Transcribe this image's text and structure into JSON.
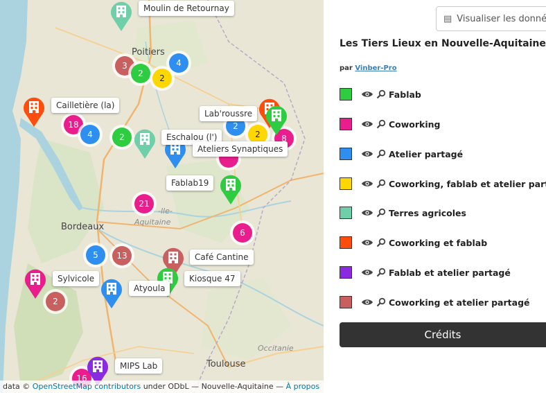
{
  "map": {
    "cities": [
      {
        "id": "poitiers",
        "name": "Poitiers"
      },
      {
        "id": "bordeaux",
        "name": "Bordeaux"
      },
      {
        "id": "toulouse",
        "name": "Toulouse"
      }
    ],
    "region_label_1": "-lle-",
    "region_label_2": "Aquitaine",
    "region_label_3": "Occitanie",
    "clusters": [
      {
        "count": "3",
        "color": "#c86060"
      },
      {
        "count": "2",
        "color": "#2ecc40"
      },
      {
        "count": "4",
        "color": "#2f8ff0"
      },
      {
        "count": "2",
        "color": "#ffd700"
      },
      {
        "count": "18",
        "color": "#e91e8c"
      },
      {
        "count": "4",
        "color": "#2f8ff0"
      },
      {
        "count": "2",
        "color": "#2ecc40"
      },
      {
        "count": "2",
        "color": "#2f8ff0"
      },
      {
        "count": "2",
        "color": "#ffd700"
      },
      {
        "count": "8",
        "color": "#e91e8c"
      },
      {
        "count": "21",
        "color": "#e91e8c"
      },
      {
        "count": "6",
        "color": "#e91e8c"
      },
      {
        "count": "5",
        "color": "#2f8ff0"
      },
      {
        "count": "13",
        "color": "#c86060"
      },
      {
        "count": "2",
        "color": "#c86060"
      },
      {
        "count": "16",
        "color": "#e91e8c"
      }
    ],
    "pins": [
      {
        "color": "#6fcfa8"
      },
      {
        "color": "#ff4d0d"
      },
      {
        "color": "#6fcfa8"
      },
      {
        "color": "#2f8ff0"
      },
      {
        "color": "#ff4d0d"
      },
      {
        "color": "#2ecc40"
      },
      {
        "color": "#2ecc40"
      },
      {
        "color": "#c86060"
      },
      {
        "color": "#2ecc40"
      },
      {
        "color": "#e91e8c"
      },
      {
        "color": "#2f8ff0"
      },
      {
        "color": "#8a2be2"
      }
    ],
    "labels": {
      "moulin": "Moulin de Retournay",
      "cailletiere": "Cailletière (la)",
      "labroussre": "Lab'roussre",
      "eschalou": "Eschalou (l')",
      "ateliers": "Ateliers Synaptiques",
      "fablab19": "Fablab19",
      "cafe": "Café Cantine",
      "kiosque": "Kiosque 47",
      "sylvicole": "Sylvicole",
      "atyoula": "Atyoula",
      "mips": "MIPS Lab"
    },
    "attribution": {
      "prefix": "data ©",
      "osm": "OpenStreetMap contributors",
      "mid": "under ODbL — Nouvelle-Aquitaine —",
      "apropos": "À propos"
    }
  },
  "panel": {
    "visualize_button": "Visualiser les données",
    "title": "Les Tiers Lieux en Nouvelle-Aquitaine",
    "author_prefix": "par",
    "author_name": "Vinber-Pro",
    "layers": [
      {
        "name": "Fablab",
        "color": "#2ecc40"
      },
      {
        "name": "Coworking",
        "color": "#e91e8c"
      },
      {
        "name": "Atelier partagé",
        "color": "#2f8ff0"
      },
      {
        "name": "Coworking, fablab et atelier partagé",
        "color": "#ffd700"
      },
      {
        "name": "Terres agricoles",
        "color": "#6fcfa8"
      },
      {
        "name": "Coworking et fablab",
        "color": "#ff4d0d"
      },
      {
        "name": "Fablab et atelier partagé",
        "color": "#8a2be2"
      },
      {
        "name": "Coworking et atelier partagé",
        "color": "#c86060"
      }
    ],
    "credits": "Crédits"
  }
}
